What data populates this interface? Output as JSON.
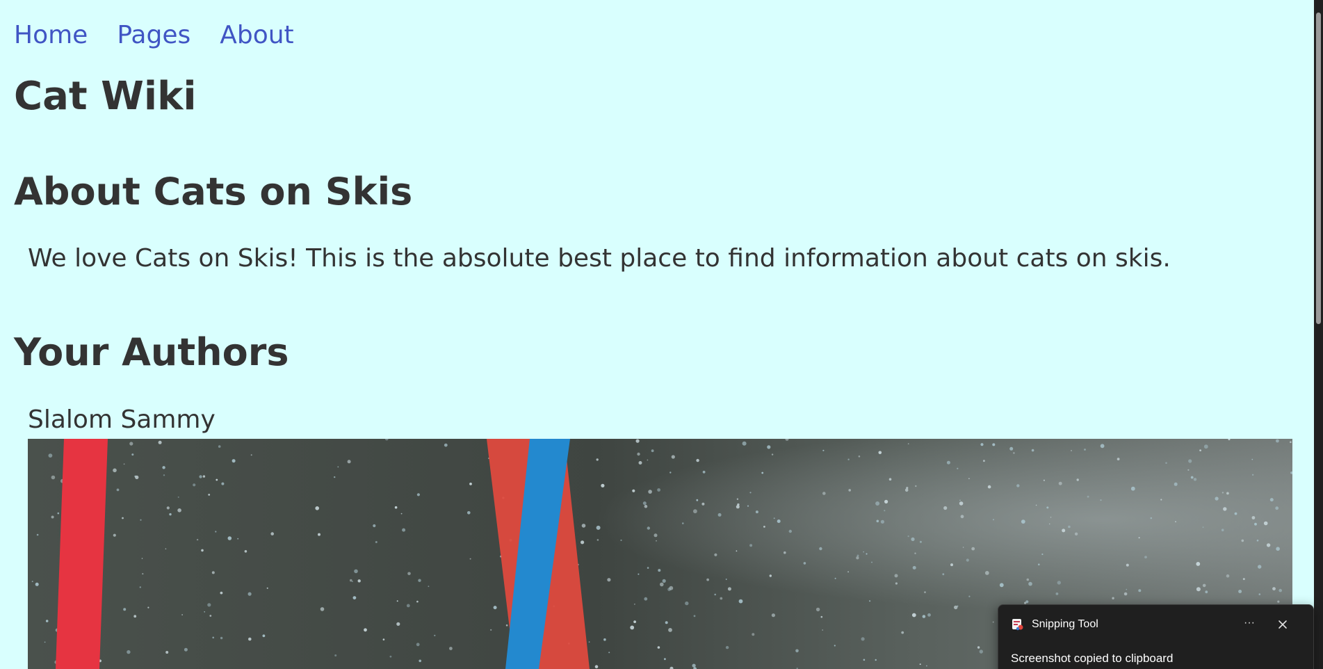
{
  "nav": {
    "items": [
      {
        "label": "Home"
      },
      {
        "label": "Pages"
      },
      {
        "label": "About"
      }
    ]
  },
  "site": {
    "title": "Cat Wiki"
  },
  "about": {
    "heading": "About Cats on Skis",
    "text": "We love Cats on Skis! This is the absolute best place to find information about cats on skis."
  },
  "authors": {
    "heading": "Your Authors",
    "list": [
      {
        "name": "Slalom Sammy"
      }
    ]
  },
  "colors": {
    "background": "#d9fffe",
    "link": "#4055c4",
    "text": "#333333",
    "gate_red": "#e63441",
    "gate_blue": "#2389cf"
  },
  "notification": {
    "app_name": "Snipping Tool",
    "message": "Screenshot copied to clipboard",
    "more_label": "···"
  }
}
